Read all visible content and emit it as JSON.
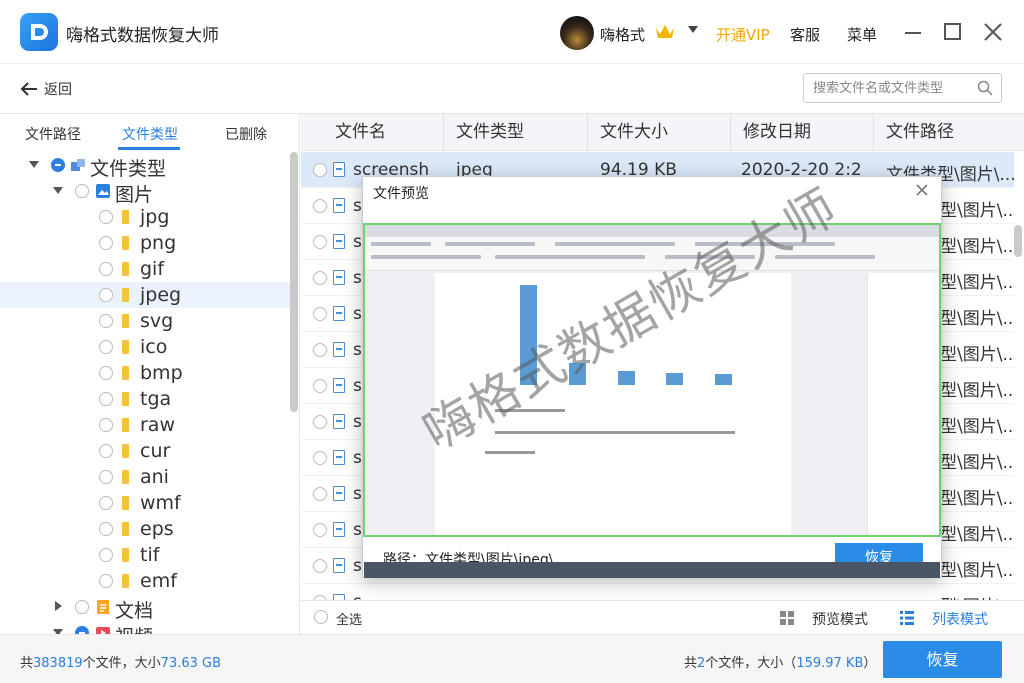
{
  "app": {
    "title": "嗨格式数据恢复大师"
  },
  "user": {
    "name": "嗨格式",
    "vip_label": "开通VIP",
    "service_label": "客服",
    "menu_label": "菜单"
  },
  "toolbar": {
    "back_label": "返回",
    "search_placeholder": "搜索文件名或文件类型"
  },
  "tabs": [
    {
      "label": "文件路径"
    },
    {
      "label": "文件类型",
      "active": true
    },
    {
      "label": "已删除"
    }
  ],
  "tree": {
    "root": "文件类型",
    "pictures": "图片",
    "image_types": [
      "jpg",
      "png",
      "gif",
      "jpeg",
      "svg",
      "ico",
      "bmp",
      "tga",
      "raw",
      "cur",
      "ani",
      "wmf",
      "eps",
      "tif",
      "emf"
    ],
    "selected": "jpeg",
    "documents": "文档",
    "video": "视频"
  },
  "table": {
    "headers": [
      "文件名",
      "文件类型",
      "文件大小",
      "修改日期",
      "文件路径"
    ],
    "first_row": {
      "name": "screensh",
      "type": "jpeg",
      "size": "94.19 KB",
      "date": "2020-2-20 2:2",
      "path": "文件类型\\图片\\..."
    },
    "row_name_prefix": "s",
    "row_paths": [
      "型\\图片\\...",
      "型\\图片\\...",
      "型\\图片\\...",
      "型\\图片\\...",
      "型\\图片\\...",
      "型\\图片\\...",
      "型\\图片\\...",
      "型\\图片\\...",
      "型\\图片\\...",
      "型\\图片\\...",
      "型\\图片\\...",
      "型\\图片\\..."
    ]
  },
  "footer": {
    "select_all": "全选",
    "preview_mode": "预览模式",
    "list_mode": "列表模式"
  },
  "status": {
    "total_prefix": "共",
    "total_count": "383819",
    "total_mid": "个文件，大小",
    "total_size": "73.63 GB",
    "sel_prefix": "共",
    "sel_count": "2",
    "sel_mid": "个文件，大小（",
    "sel_size": "159.97 KB",
    "sel_suffix": "）",
    "recover": "恢复"
  },
  "dialog": {
    "title": "文件预览",
    "path": "路径：文件类型\\图片\\jpeg\\",
    "recover": "恢复"
  },
  "watermark": "嗨格式数据恢复大师",
  "colors": {
    "accent": "#2b7fe0",
    "vip": "#f0a800",
    "preview_border": "#6fd36f"
  }
}
